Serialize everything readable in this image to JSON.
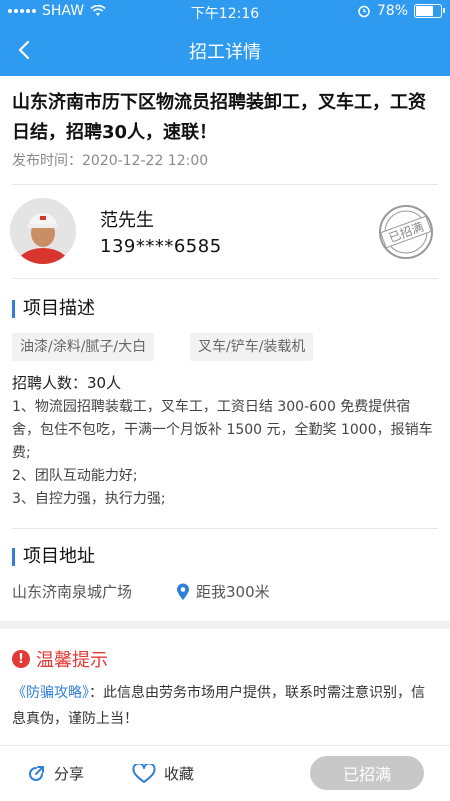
{
  "status_bar": {
    "carrier": "SHAW",
    "time": "下午12:16",
    "battery": "78%",
    "battery_level": 0.78
  },
  "nav": {
    "title": "招工详情"
  },
  "job": {
    "title": "山东济南市历下区物流员招聘装卸工，叉车工，工资日结，招聘30人，速联！",
    "publish_time": "发布时间：2020-12-22 12:00"
  },
  "contact": {
    "name": "范先生",
    "phone": "139****6585",
    "stamp_text": "已招满"
  },
  "project_desc": {
    "title": "项目描述",
    "tags": [
      "油漆/涂料/腻子/大白",
      "叉车/铲车/装载机"
    ],
    "recruit_count": "招聘人数：30人",
    "description": "1、物流园招聘装载工，叉车工，工资日结 300-600 免费提供宿舍，包住不包吃，干满一个月饭补 1500 元，全勤奖 1000，报销车费;\n2、团队互动能力好;\n3、自控力强，执行力强;"
  },
  "project_address": {
    "title": "项目地址",
    "address": "山东济南泉城广场",
    "distance": "距我300米"
  },
  "tips": {
    "title": "温馨提示",
    "link_text": "《防骗攻略》",
    "text": "：此信息由劳务市场用户提供，联系时需注意识别，信息真伪，谨防上当！"
  },
  "bottom": {
    "share": "分享",
    "favorite": "收藏",
    "status_button": "已招满"
  },
  "colors": {
    "primary": "#2f9bf0",
    "accent_blue": "#2f7fd8",
    "warning_red": "#e53935",
    "disabled_gray": "#c8c8c8"
  }
}
